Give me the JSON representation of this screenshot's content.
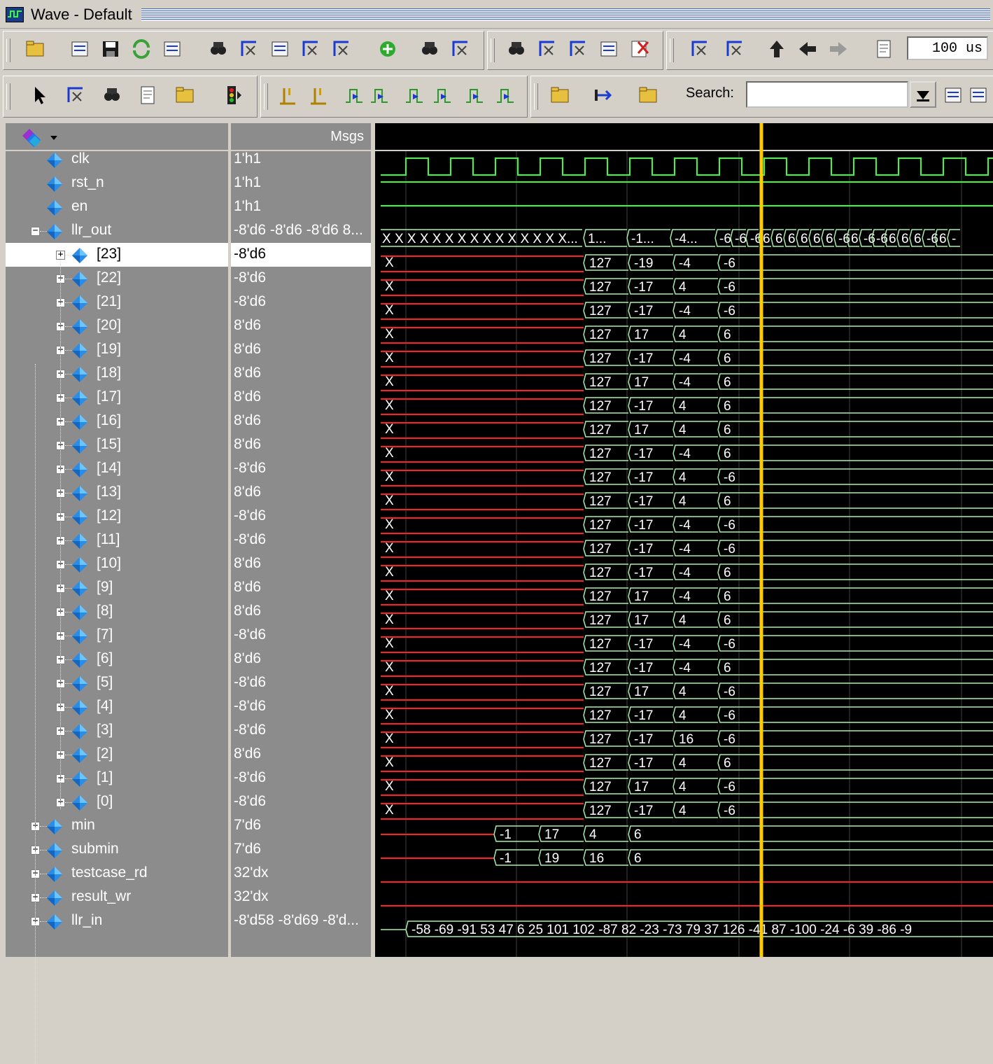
{
  "window": {
    "title": "Wave - Default"
  },
  "toolbar": {
    "time_value": "100 us",
    "search_label": "Search:",
    "search_value": "",
    "icons_row1": [
      "new-file-icon",
      "open-folder-icon",
      "save-icon",
      "reload-icon",
      "print-icon",
      "cut-icon",
      "copy-icon",
      "paste-icon",
      "undo-icon",
      "redo-icon",
      "add-icon",
      "find-binoculars-icon",
      "list-icon",
      "step-over-icon",
      "help-icon",
      "calculator-icon",
      "break-icon",
      "delete-icon",
      "copy-waves-icon",
      "sort-icon",
      "up-arrow-icon",
      "left-arrow-icon",
      "right-arrow-icon",
      "restart-icon"
    ],
    "icons_row2": [
      "select-pointer-icon",
      "zoom-icon",
      "pan-icon",
      "measure-icon",
      "dataflow-icon",
      "stop-traffic-light-icon",
      "cursor-add-icon",
      "cursor-delete-icon",
      "prev-edge-icon",
      "next-edge-icon",
      "prev-falling-icon",
      "next-falling-icon",
      "prev-rising-icon",
      "next-rising-icon",
      "insert-divider-icon",
      "expand-icon",
      "collapse-icon",
      "search-prev-icon",
      "search-next-icon"
    ]
  },
  "panes": {
    "values_header": "Msgs"
  },
  "signals": [
    {
      "name": "clk",
      "value": "1'h1",
      "level": 0,
      "expand": "none",
      "type": "clock"
    },
    {
      "name": "rst_n",
      "value": "1'h1",
      "level": 0,
      "expand": "none",
      "type": "high"
    },
    {
      "name": "en",
      "value": "1'h1",
      "level": 0,
      "expand": "none",
      "type": "high"
    },
    {
      "name": "llr_out",
      "value": "-8'd6 -8'd6 -8'd6 8...",
      "level": 0,
      "expand": "minus",
      "type": "bus_top"
    },
    {
      "name": "[23]",
      "value": "-8'd6",
      "level": 1,
      "expand": "plus",
      "type": "bus",
      "w": [
        "127",
        "-19",
        "-4",
        "-6"
      ]
    },
    {
      "name": "[22]",
      "value": "-8'd6",
      "level": 1,
      "expand": "plus",
      "type": "bus",
      "w": [
        "127",
        "-17",
        "4",
        "-6"
      ]
    },
    {
      "name": "[21]",
      "value": "-8'd6",
      "level": 1,
      "expand": "plus",
      "type": "bus",
      "w": [
        "127",
        "-17",
        "-4",
        "-6"
      ]
    },
    {
      "name": "[20]",
      "value": "8'd6",
      "level": 1,
      "expand": "plus",
      "type": "bus",
      "w": [
        "127",
        "17",
        "4",
        "6"
      ]
    },
    {
      "name": "[19]",
      "value": "8'd6",
      "level": 1,
      "expand": "plus",
      "type": "bus",
      "w": [
        "127",
        "-17",
        "-4",
        "6"
      ]
    },
    {
      "name": "[18]",
      "value": "8'd6",
      "level": 1,
      "expand": "plus",
      "type": "bus",
      "w": [
        "127",
        "17",
        "-4",
        "6"
      ]
    },
    {
      "name": "[17]",
      "value": "8'd6",
      "level": 1,
      "expand": "plus",
      "type": "bus",
      "w": [
        "127",
        "-17",
        "4",
        "6"
      ]
    },
    {
      "name": "[16]",
      "value": "8'd6",
      "level": 1,
      "expand": "plus",
      "type": "bus",
      "w": [
        "127",
        "17",
        "4",
        "6"
      ]
    },
    {
      "name": "[15]",
      "value": "8'd6",
      "level": 1,
      "expand": "plus",
      "type": "bus",
      "w": [
        "127",
        "-17",
        "-4",
        "6"
      ]
    },
    {
      "name": "[14]",
      "value": "-8'd6",
      "level": 1,
      "expand": "plus",
      "type": "bus",
      "w": [
        "127",
        "-17",
        "4",
        "-6"
      ]
    },
    {
      "name": "[13]",
      "value": "8'd6",
      "level": 1,
      "expand": "plus",
      "type": "bus",
      "w": [
        "127",
        "-17",
        "4",
        "6"
      ]
    },
    {
      "name": "[12]",
      "value": "-8'd6",
      "level": 1,
      "expand": "plus",
      "type": "bus",
      "w": [
        "127",
        "-17",
        "-4",
        "-6"
      ]
    },
    {
      "name": "[11]",
      "value": "-8'd6",
      "level": 1,
      "expand": "plus",
      "type": "bus",
      "w": [
        "127",
        "-17",
        "-4",
        "-6"
      ]
    },
    {
      "name": "[10]",
      "value": "8'd6",
      "level": 1,
      "expand": "plus",
      "type": "bus",
      "w": [
        "127",
        "-17",
        "-4",
        "6"
      ]
    },
    {
      "name": "[9]",
      "value": "8'd6",
      "level": 1,
      "expand": "plus",
      "type": "bus",
      "w": [
        "127",
        "17",
        "-4",
        "6"
      ]
    },
    {
      "name": "[8]",
      "value": "8'd6",
      "level": 1,
      "expand": "plus",
      "type": "bus",
      "w": [
        "127",
        "17",
        "4",
        "6"
      ]
    },
    {
      "name": "[7]",
      "value": "-8'd6",
      "level": 1,
      "expand": "plus",
      "type": "bus",
      "w": [
        "127",
        "-17",
        "-4",
        "-6"
      ]
    },
    {
      "name": "[6]",
      "value": "8'd6",
      "level": 1,
      "expand": "plus",
      "type": "bus",
      "w": [
        "127",
        "-17",
        "-4",
        "6"
      ]
    },
    {
      "name": "[5]",
      "value": "-8'd6",
      "level": 1,
      "expand": "plus",
      "type": "bus",
      "w": [
        "127",
        "17",
        "4",
        "-6"
      ]
    },
    {
      "name": "[4]",
      "value": "-8'd6",
      "level": 1,
      "expand": "plus",
      "type": "bus",
      "w": [
        "127",
        "-17",
        "4",
        "-6"
      ]
    },
    {
      "name": "[3]",
      "value": "-8'd6",
      "level": 1,
      "expand": "plus",
      "type": "bus",
      "w": [
        "127",
        "-17",
        "16",
        "-6"
      ]
    },
    {
      "name": "[2]",
      "value": "8'd6",
      "level": 1,
      "expand": "plus",
      "type": "bus",
      "w": [
        "127",
        "-17",
        "4",
        "6"
      ]
    },
    {
      "name": "[1]",
      "value": "-8'd6",
      "level": 1,
      "expand": "plus",
      "type": "bus",
      "w": [
        "127",
        "17",
        "4",
        "-6"
      ]
    },
    {
      "name": "[0]",
      "value": "-8'd6",
      "level": 1,
      "expand": "plus",
      "type": "bus",
      "w": [
        "127",
        "-17",
        "4",
        "-6"
      ]
    },
    {
      "name": "min",
      "value": "7'd6",
      "level": 0,
      "expand": "plus",
      "type": "small",
      "w": [
        "-1",
        "17",
        "4",
        "6"
      ]
    },
    {
      "name": "submin",
      "value": "7'd6",
      "level": 0,
      "expand": "plus",
      "type": "small",
      "w": [
        "-1",
        "19",
        "16",
        "6"
      ]
    },
    {
      "name": "testcase_rd",
      "value": "32'dx",
      "level": 0,
      "expand": "plus",
      "type": "red"
    },
    {
      "name": "result_wr",
      "value": "32'dx",
      "level": 0,
      "expand": "plus",
      "type": "red"
    },
    {
      "name": "llr_in",
      "value": "-8'd58 -8'd69 -8'd...",
      "level": 0,
      "expand": "plus",
      "type": "llrin"
    }
  ],
  "waveforms": {
    "unknown_label": "X",
    "llr_out_top_x": "X X X X X X X X X X X X X X X...",
    "llr_out_top_bus": [
      "1...",
      "-1...",
      "-4...",
      "-6",
      "-6",
      "-6",
      "6",
      "6",
      "6",
      "6",
      "6",
      "6",
      "-6",
      "6",
      "-6",
      "-6",
      "6",
      "6",
      "6",
      "-6",
      "6",
      "-"
    ],
    "llr_in": [
      "-58",
      "-69",
      "-91",
      "53",
      "47",
      "6",
      "25",
      "101",
      "102",
      "-87",
      "82",
      "-23",
      "-73",
      "79",
      "37",
      "126",
      "-41",
      "87",
      "-100",
      "-24",
      "-6",
      "39",
      "-86",
      "-9"
    ]
  },
  "colors": {
    "green": "#33ff33",
    "pale_green": "#a8f0a8",
    "red": "#ff2020",
    "cursor": "#ffcc00",
    "grid": "#404040"
  }
}
